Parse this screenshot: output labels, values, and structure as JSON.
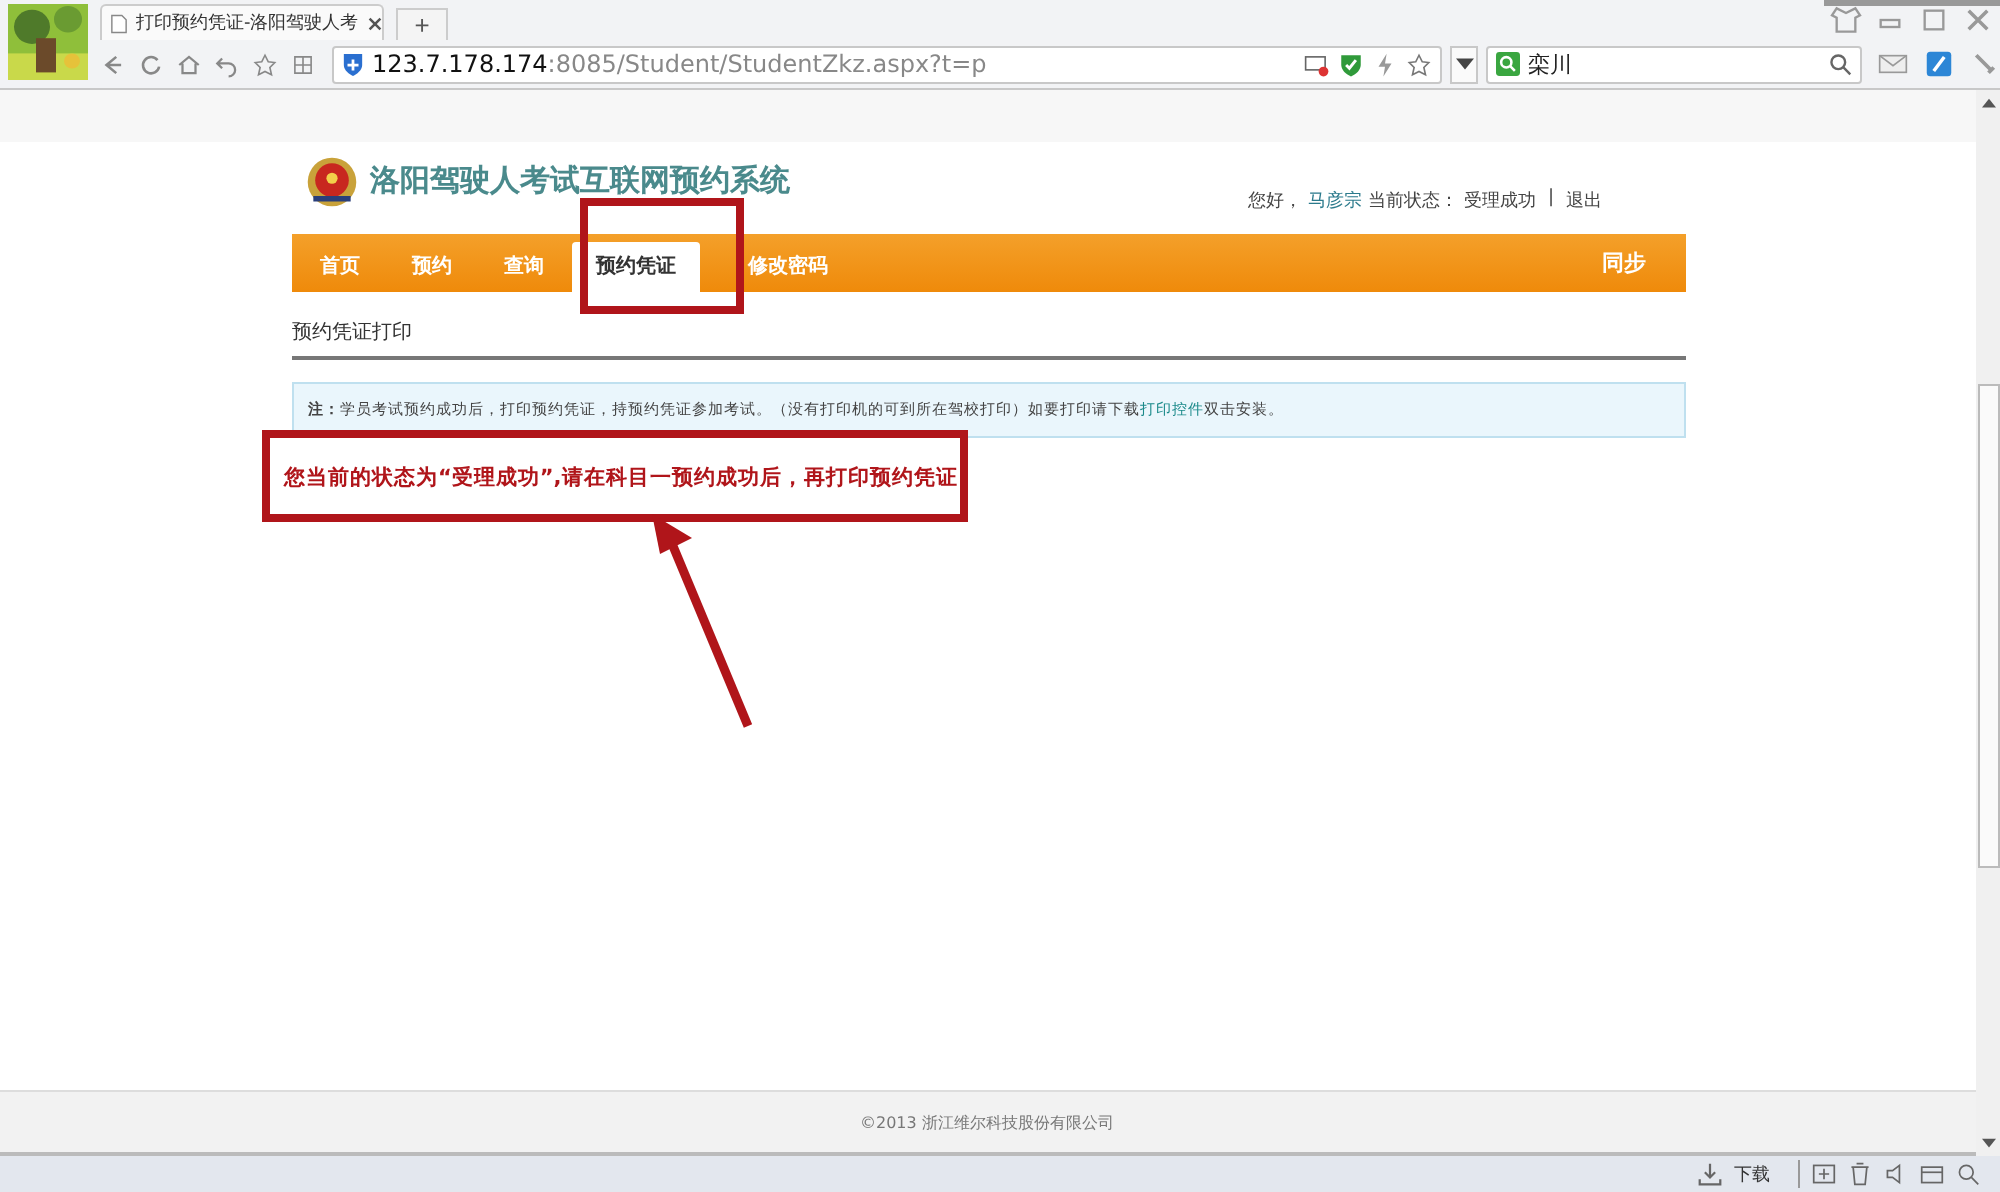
{
  "browser": {
    "tab_title": "打印预约凭证-洛阳驾驶人考",
    "new_tab": "+",
    "url_host": "123.7.178.174",
    "url_rest": ":8085/Student/StudentZkz.aspx?t=p",
    "search_value": "栾川"
  },
  "header": {
    "site_title": "洛阳驾驶人考试互联网预约系统",
    "greeting": "您好，",
    "user_name": "马彦宗",
    "status_label": "当前状态：",
    "status_value": "受理成功",
    "separator": "|",
    "logout": "退出"
  },
  "nav": {
    "items": [
      {
        "label": "首页",
        "selected": false
      },
      {
        "label": "预约",
        "selected": false
      },
      {
        "label": "查询",
        "selected": false
      },
      {
        "label": "预约凭证",
        "selected": true
      },
      {
        "label": "修改密码",
        "selected": false
      }
    ],
    "right": "同步"
  },
  "section_title": "预约凭证打印",
  "notice": {
    "label": "注：",
    "text": "学员考试预约成功后，打印预约凭证，持预约凭证参加考试。（没有打印机的可到所在驾校打印）如要打印请下载",
    "link": "打印控件",
    "after": "双击安装。"
  },
  "message": "您当前的状态为“受理成功”,请在科目一预约成功后，再打印预约凭证",
  "footer": "©2013 浙江维尔科技股份有限公司",
  "status_bar": {
    "download": "下载"
  }
}
